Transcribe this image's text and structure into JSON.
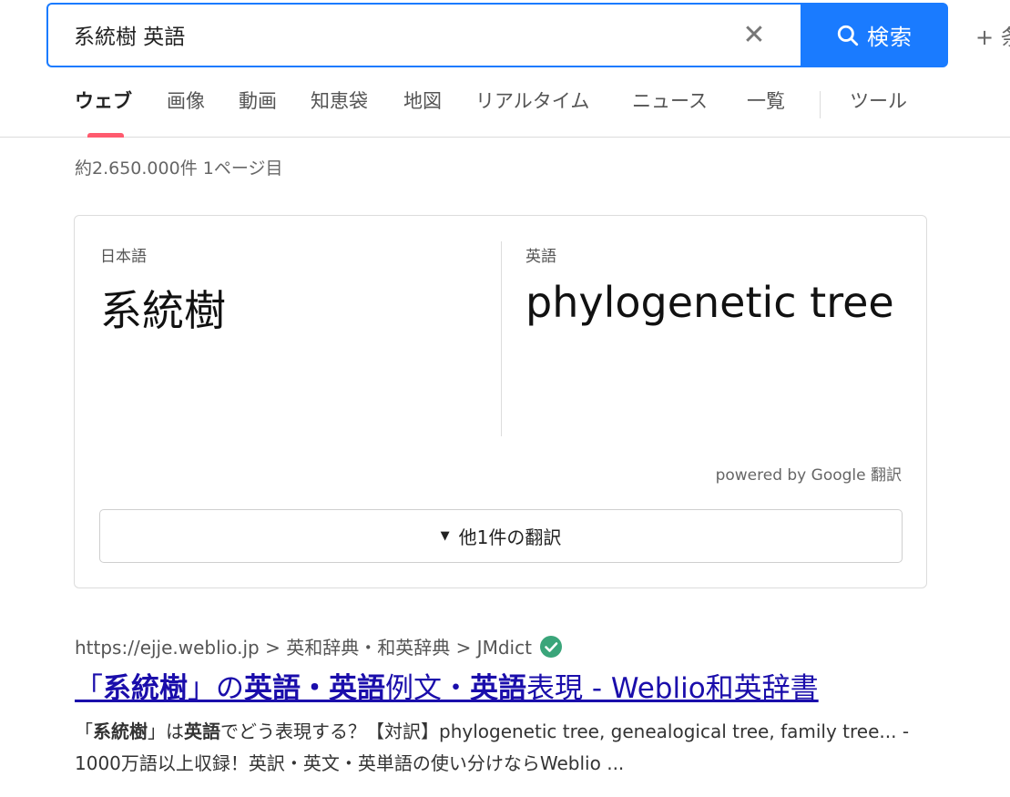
{
  "search": {
    "query": "系統樹 英語",
    "clear_icon": "close-icon",
    "button_label": "検索",
    "button_color": "#1a7bff",
    "more_conditions_label": "+ 条"
  },
  "tabs": [
    {
      "label": "ウェブ",
      "active": true
    },
    {
      "label": "画像"
    },
    {
      "label": "動画"
    },
    {
      "label": "知恵袋"
    },
    {
      "label": "地図"
    },
    {
      "label": "リアルタイム"
    },
    {
      "label": "ニュース"
    },
    {
      "label": "一覧"
    },
    {
      "label": "ツール"
    }
  ],
  "result_count": "約2.650.000件  1ページ目",
  "translation": {
    "source_lang": "日本語",
    "source_text": "系統樹",
    "target_lang": "英語",
    "target_text": "phylogenetic tree",
    "powered_by": "powered by Google 翻訳",
    "more_label": "他1件の翻訳"
  },
  "result": {
    "url": "https://ejje.weblio.jp > 英和辞典・和英辞典 > JMdict",
    "title_parts": [
      "「",
      "系統樹",
      "」の",
      "英語",
      "・",
      "英語",
      "例文・",
      "英語",
      "表現 - Weblio和英辞書"
    ],
    "snippet_parts": [
      "「",
      "系統樹",
      "」は",
      "英語",
      "でどう表現する？【対訳】phylogenetic tree, genealogical tree, family tree... - 1000万語以上収録！英訳・英文・英単語の使い分けならWeblio ..."
    ],
    "link_color": "#1a0dab"
  }
}
